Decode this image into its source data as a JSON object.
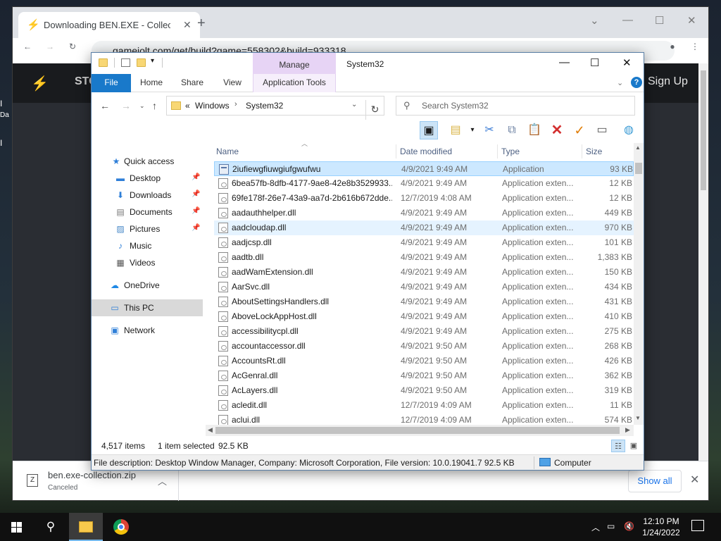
{
  "desktop": {
    "chars": [
      "I",
      "Da",
      "I"
    ]
  },
  "chrome": {
    "tab_title": "Downloading BEN.EXE - Collectio",
    "url": "gamejolt.com/get/build?game=558302&build=933318",
    "site": {
      "logo": "⚡",
      "nav_partial": "STO",
      "help": "?",
      "signup": "Sign Up"
    },
    "download": {
      "filename": "ben.exe-collection.zip",
      "status": "Canceled",
      "show_all": "Show all"
    }
  },
  "explorer": {
    "title": "System32",
    "ribbon_context_tab": "Manage",
    "ribbon_tabs": [
      "File",
      "Home",
      "Share",
      "View",
      "Application Tools"
    ],
    "breadcrumb": {
      "prefix": "«",
      "parts": [
        "Windows",
        "System32"
      ]
    },
    "search_placeholder": "Search System32",
    "columns": [
      "Name",
      "Date modified",
      "Type",
      "Size"
    ],
    "nav": [
      {
        "label": "Quick access"
      },
      {
        "label": "Desktop"
      },
      {
        "label": "Downloads"
      },
      {
        "label": "Documents"
      },
      {
        "label": "Pictures"
      },
      {
        "label": "Music"
      },
      {
        "label": "Videos"
      },
      {
        "label": "OneDrive"
      },
      {
        "label": "This PC"
      },
      {
        "label": "Network"
      }
    ],
    "files": [
      {
        "name": "2iufiewgfiuwgiufgwufwu",
        "date": "4/9/2021 9:49 AM",
        "type": "Application",
        "size": "93 KB"
      },
      {
        "name": "6bea57fb-8dfb-4177-9ae8-42e8b3529933...",
        "date": "4/9/2021 9:49 AM",
        "type": "Application exten...",
        "size": "12 KB"
      },
      {
        "name": "69fe178f-26e7-43a9-aa7d-2b616b672dde...",
        "date": "12/7/2019 4:08 AM",
        "type": "Application exten...",
        "size": "12 KB"
      },
      {
        "name": "aadauthhelper.dll",
        "date": "4/9/2021 9:49 AM",
        "type": "Application exten...",
        "size": "449 KB"
      },
      {
        "name": "aadcloudap.dll",
        "date": "4/9/2021 9:49 AM",
        "type": "Application exten...",
        "size": "970 KB"
      },
      {
        "name": "aadjcsp.dll",
        "date": "4/9/2021 9:49 AM",
        "type": "Application exten...",
        "size": "101 KB"
      },
      {
        "name": "aadtb.dll",
        "date": "4/9/2021 9:49 AM",
        "type": "Application exten...",
        "size": "1,383 KB"
      },
      {
        "name": "aadWamExtension.dll",
        "date": "4/9/2021 9:49 AM",
        "type": "Application exten...",
        "size": "150 KB"
      },
      {
        "name": "AarSvc.dll",
        "date": "4/9/2021 9:49 AM",
        "type": "Application exten...",
        "size": "434 KB"
      },
      {
        "name": "AboutSettingsHandlers.dll",
        "date": "4/9/2021 9:49 AM",
        "type": "Application exten...",
        "size": "431 KB"
      },
      {
        "name": "AboveLockAppHost.dll",
        "date": "4/9/2021 9:49 AM",
        "type": "Application exten...",
        "size": "410 KB"
      },
      {
        "name": "accessibilitycpl.dll",
        "date": "4/9/2021 9:49 AM",
        "type": "Application exten...",
        "size": "275 KB"
      },
      {
        "name": "accountaccessor.dll",
        "date": "4/9/2021 9:50 AM",
        "type": "Application exten...",
        "size": "268 KB"
      },
      {
        "name": "AccountsRt.dll",
        "date": "4/9/2021 9:50 AM",
        "type": "Application exten...",
        "size": "426 KB"
      },
      {
        "name": "AcGenral.dll",
        "date": "4/9/2021 9:50 AM",
        "type": "Application exten...",
        "size": "362 KB"
      },
      {
        "name": "AcLayers.dll",
        "date": "4/9/2021 9:50 AM",
        "type": "Application exten...",
        "size": "319 KB"
      },
      {
        "name": "acledit.dll",
        "date": "12/7/2019 4:09 AM",
        "type": "Application exten...",
        "size": "11 KB"
      },
      {
        "name": "aclui.dll",
        "date": "12/7/2019 4:09 AM",
        "type": "Application exten...",
        "size": "574 KB"
      }
    ],
    "status": {
      "items": "4,517 items",
      "selected": "1 item selected",
      "size": "92.5 KB"
    },
    "info": {
      "description": "File description: Desktop Window Manager, Company: Microsoft Corporation, File version: 10.0.19041.7  92.5 KB",
      "location": "Computer"
    }
  },
  "taskbar": {
    "time": "12:10 PM",
    "date": "1/24/2022"
  },
  "colors": {
    "accent": "#1979ca",
    "manage_tab": "#e7d4f5",
    "selection": "#cce8ff",
    "delete": "#d32f2f",
    "check": "#e07b00"
  }
}
